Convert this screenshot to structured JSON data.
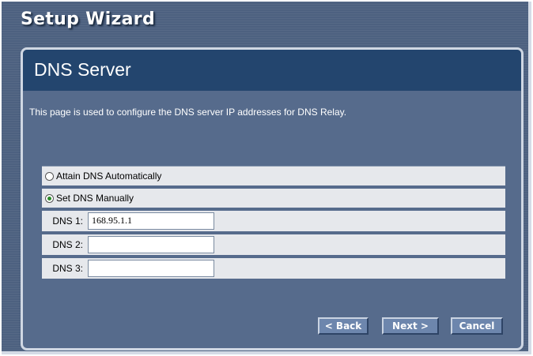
{
  "window": {
    "title": "Setup Wizard"
  },
  "panel": {
    "heading": "DNS Server",
    "description": "This page is used to configure the DNS server IP addresses for DNS Relay."
  },
  "options": {
    "auto_label": "Attain DNS Automatically",
    "manual_label": "Set DNS Manually",
    "selected": "manual"
  },
  "dns": [
    {
      "label": "DNS 1:",
      "value": "168.95.1.1"
    },
    {
      "label": "DNS 2:",
      "value": ""
    },
    {
      "label": "DNS 3:",
      "value": ""
    }
  ],
  "buttons": {
    "back": "< Back",
    "next": "Next >",
    "cancel": "Cancel"
  }
}
